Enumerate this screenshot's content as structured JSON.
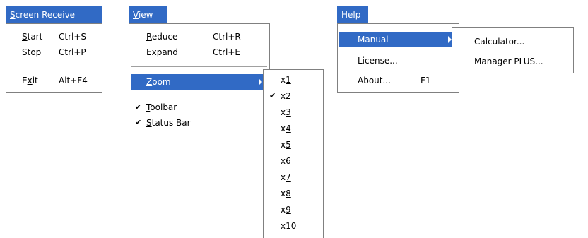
{
  "screen_receive": {
    "title_prefix": "",
    "title_accel": "S",
    "title_rest": "creen Receive",
    "items": [
      {
        "pre": "",
        "acc": "S",
        "post": "tart",
        "shortcut": "Ctrl+S"
      },
      {
        "pre": "Sto",
        "acc": "p",
        "post": "",
        "shortcut": "Ctrl+P"
      },
      {
        "pre": "E",
        "acc": "x",
        "post": "it",
        "shortcut": "Alt+F4"
      }
    ]
  },
  "view": {
    "title_accel": "V",
    "title_rest": "iew",
    "items": [
      {
        "pre": "",
        "acc": "R",
        "post": "educe",
        "shortcut": "Ctrl+R"
      },
      {
        "pre": "",
        "acc": "E",
        "post": "xpand",
        "shortcut": "Ctrl+E"
      },
      {
        "pre": "",
        "acc": "Z",
        "post": "oom",
        "shortcut": ""
      },
      {
        "pre": "",
        "acc": "T",
        "post": "oolbar",
        "shortcut": "",
        "check": "✔"
      },
      {
        "pre": "",
        "acc": "S",
        "post": "tatus Bar",
        "shortcut": "",
        "check": "✔"
      }
    ]
  },
  "zoom": {
    "items": [
      {
        "pre": "x",
        "acc": "1",
        "check": ""
      },
      {
        "pre": "x",
        "acc": "2",
        "check": "✔"
      },
      {
        "pre": "x",
        "acc": "3",
        "check": ""
      },
      {
        "pre": "x",
        "acc": "4",
        "check": ""
      },
      {
        "pre": "x",
        "acc": "5",
        "check": ""
      },
      {
        "pre": "x",
        "acc": "6",
        "check": ""
      },
      {
        "pre": "x",
        "acc": "7",
        "check": ""
      },
      {
        "pre": "x",
        "acc": "8",
        "check": ""
      },
      {
        "pre": "x",
        "acc": "9",
        "check": ""
      },
      {
        "pre": "x1",
        "acc": "0",
        "check": ""
      }
    ]
  },
  "help": {
    "title": "Help",
    "items": [
      {
        "label": "Manual",
        "shortcut": ""
      },
      {
        "label": "License...",
        "shortcut": ""
      },
      {
        "label": "About...",
        "shortcut": "F1"
      }
    ]
  },
  "manual_submenu": {
    "items": [
      {
        "label": "Calculator..."
      },
      {
        "label": "Manager PLUS..."
      }
    ]
  },
  "colors": {
    "highlight": "#316ac5",
    "border": "#808080"
  }
}
